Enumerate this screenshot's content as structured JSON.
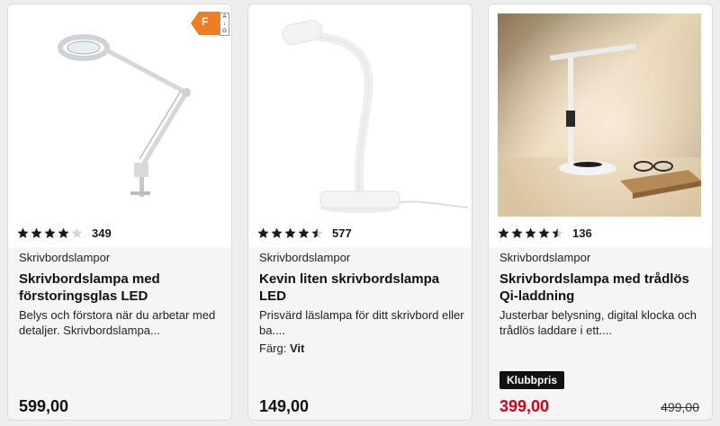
{
  "products": [
    {
      "rating": 4,
      "rating_count": "349",
      "category": "Skrivbordslampor",
      "title": "Skrivbordslampa med förstoringsglas LED",
      "description": "Belys och förstora när du arbetar med detaljer. Skrivbordslampa...",
      "price": "599,00",
      "energy_label": {
        "class": "F",
        "scale_top": "A",
        "scale_bottom": "G"
      }
    },
    {
      "rating": 4.5,
      "rating_count": "577",
      "category": "Skrivbordslampor",
      "title": "Kevin liten skrivbordslampa LED",
      "description": "Prisvärd läslampa för ditt skrivbord eller ba....",
      "color_label": "Färg:",
      "color_value": "Vit",
      "price": "149,00"
    },
    {
      "rating": 4.5,
      "rating_count": "136",
      "category": "Skrivbordslampor",
      "title": "Skrivbordslampa med trådlös Qi-laddning",
      "description": "Justerbar belysning, digital klocka och trådlös laddare i ett....",
      "badge": "Klubbpris",
      "price": "399,00",
      "old_price": "499,00"
    }
  ],
  "colors": {
    "sale_price": "#d0011b",
    "badge_bg": "#111111",
    "star": "#1a1a1a",
    "energy_f": "#ef7d22"
  }
}
